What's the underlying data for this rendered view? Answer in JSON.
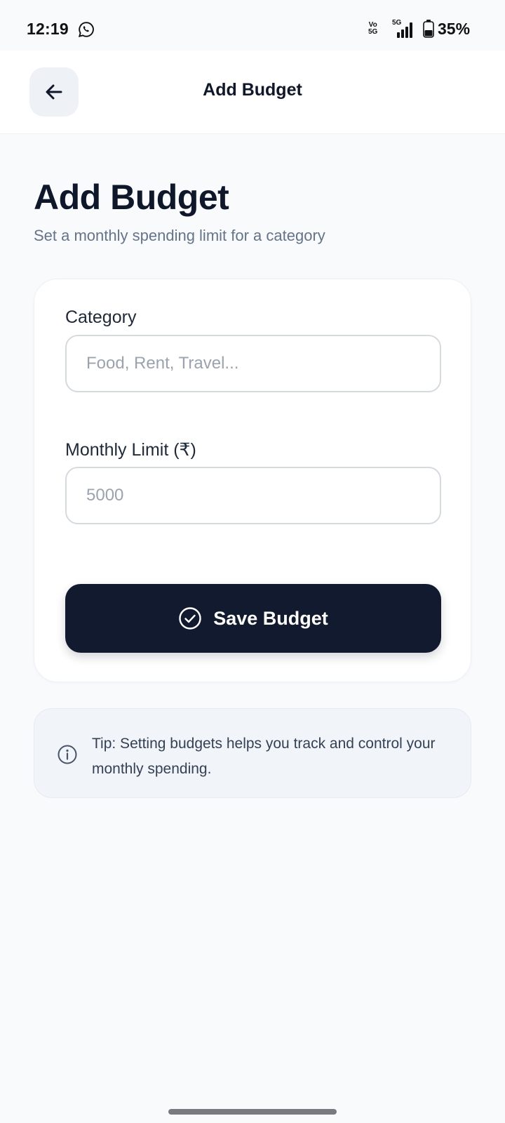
{
  "status_bar": {
    "time": "12:19",
    "volte_top": "Vo",
    "volte_bottom": "5G",
    "network": "5G",
    "battery": "35%",
    "icons": [
      "whatsapp-icon",
      "signal-icon",
      "battery-icon"
    ]
  },
  "app_bar": {
    "back_icon": "arrow-left-icon",
    "title": "Add Budget"
  },
  "header": {
    "title": "Add Budget",
    "subtitle": "Set a monthly spending limit for a category"
  },
  "form": {
    "category_label": "Category",
    "category_placeholder": "Food, Rent, Travel...",
    "limit_label": "Monthly Limit (₹)",
    "limit_placeholder": "5000",
    "save_label": "Save Budget",
    "save_icon": "check-circle-icon"
  },
  "tip": {
    "icon": "info-icon",
    "text": "Tip: Setting budgets helps you track and control your monthly spending."
  },
  "colors": {
    "background": "#f8fafc",
    "primary_dark": "#111a2e",
    "text_primary": "#0f172a",
    "text_muted": "#64748b"
  }
}
